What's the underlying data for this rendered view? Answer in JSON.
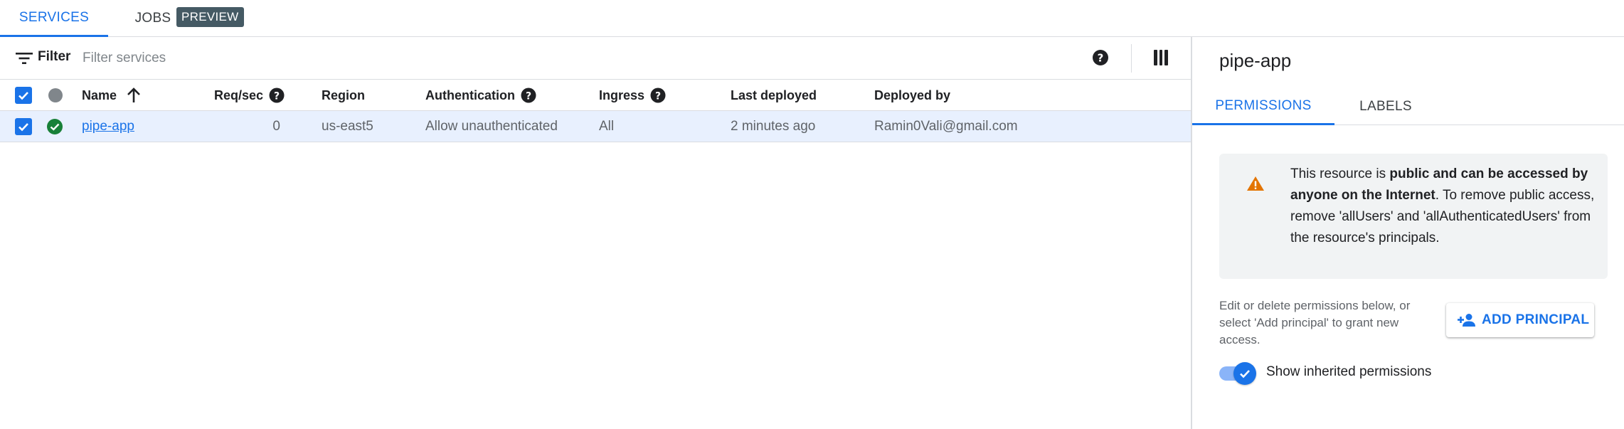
{
  "tabs": {
    "services": "SERVICES",
    "jobs": "JOBS",
    "preview_badge": "PREVIEW"
  },
  "filter": {
    "label": "Filter",
    "placeholder": "Filter services"
  },
  "table": {
    "headers": {
      "name": "Name",
      "req_sec": "Req/sec",
      "region": "Region",
      "authentication": "Authentication",
      "ingress": "Ingress",
      "last_deployed": "Last deployed",
      "deployed_by": "Deployed by"
    },
    "sort": {
      "column": "name",
      "direction": "ascending"
    },
    "rows": [
      {
        "selected": true,
        "status": "ok",
        "name": "pipe-app",
        "req_sec": "0",
        "region": "us-east5",
        "authentication": "Allow unauthenticated",
        "ingress": "All",
        "last_deployed": "2 minutes ago",
        "deployed_by": "Ramin0Vali@gmail.com"
      }
    ]
  },
  "panel": {
    "title": "pipe-app",
    "tabs": {
      "permissions": "PERMISSIONS",
      "labels": "LABELS"
    },
    "warning": {
      "prefix": "This resource is ",
      "bold": "public and can be accessed by anyone on the Internet",
      "suffix": ". To remove public access, remove 'allUsers' and 'allAuthenticatedUsers' from the resource's principals."
    },
    "help_text": "Edit or delete permissions below, or select 'Add principal' to grant new access.",
    "add_principal_label": "ADD PRINCIPAL",
    "inherited_toggle": {
      "label": "Show inherited permissions",
      "checked": true
    }
  },
  "colors": {
    "accent": "#1a73e8",
    "warning": "#e37400",
    "success": "#188038",
    "selected_row": "#e8f0fe",
    "preview_badge": "#455a64"
  },
  "icons": {
    "filter": "filter-icon",
    "help": "help-icon",
    "columns": "columns-icon",
    "sort_up": "arrow-up-icon",
    "status_ok": "check-circle-icon",
    "warning": "warning-icon",
    "add_person": "person-add-icon"
  }
}
